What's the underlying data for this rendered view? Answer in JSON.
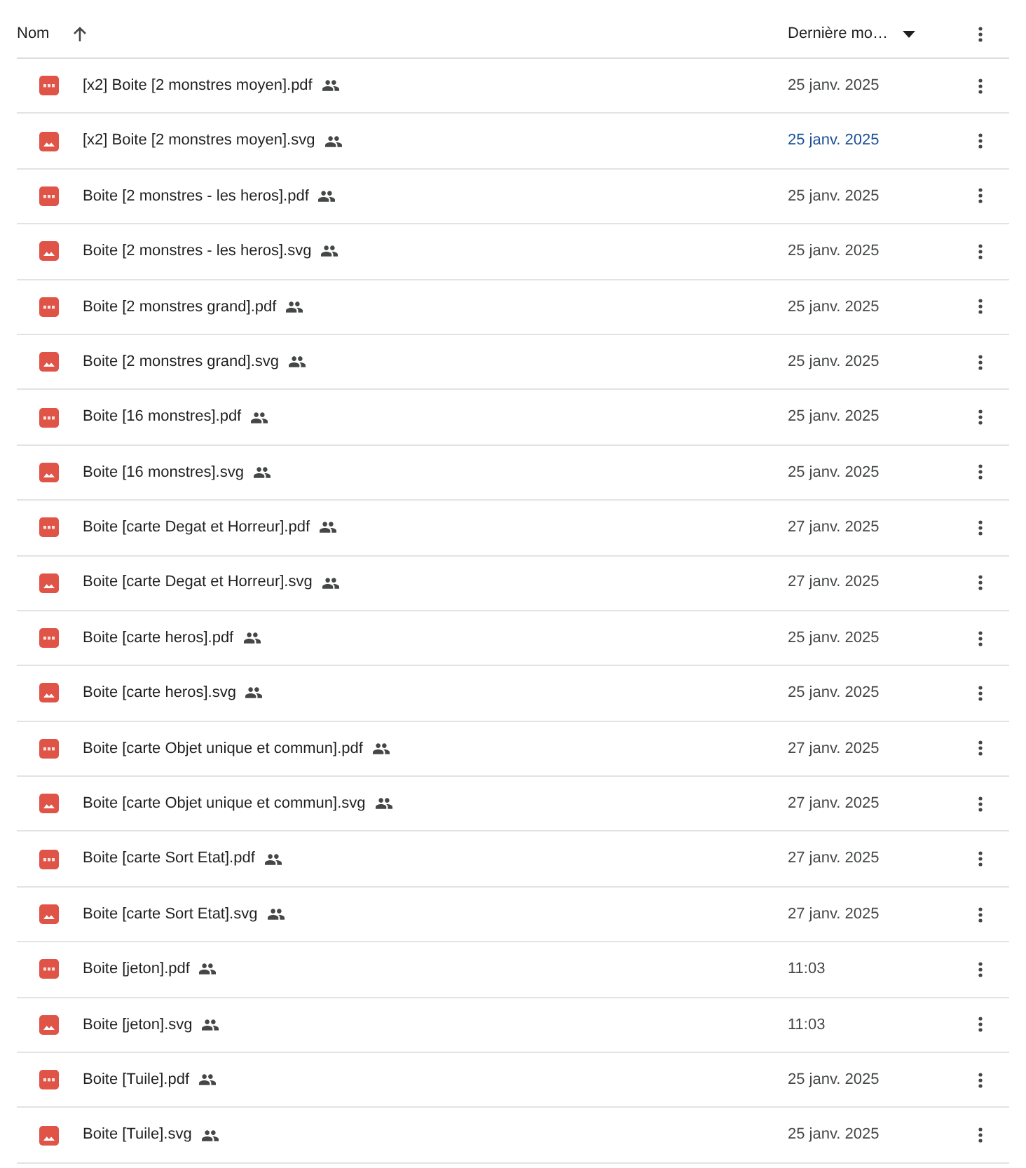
{
  "columns": [
    {
      "label": "Nom",
      "kind": "sort-ascending"
    },
    {
      "label": "Dernière mo…",
      "kind": "dropdown"
    }
  ],
  "rows": [
    {
      "name": "[x2] Boite [2 monstres moyen].pdf",
      "kind": "pdf",
      "shared": true,
      "modified": "25 janv. 2025",
      "hovered": false
    },
    {
      "name": "[x2] Boite [2 monstres moyen].svg",
      "kind": "image",
      "shared": true,
      "modified": "25 janv. 2025",
      "hovered": true
    },
    {
      "name": "Boite [2 monstres - les heros].pdf",
      "kind": "pdf",
      "shared": true,
      "modified": "25 janv. 2025",
      "hovered": false
    },
    {
      "name": "Boite [2 monstres - les heros].svg",
      "kind": "image",
      "shared": true,
      "modified": "25 janv. 2025",
      "hovered": false
    },
    {
      "name": "Boite [2 monstres grand].pdf",
      "kind": "pdf",
      "shared": true,
      "modified": "25 janv. 2025",
      "hovered": false
    },
    {
      "name": "Boite [2 monstres grand].svg",
      "kind": "image",
      "shared": true,
      "modified": "25 janv. 2025",
      "hovered": false
    },
    {
      "name": "Boite [16 monstres].pdf",
      "kind": "pdf",
      "shared": true,
      "modified": "25 janv. 2025",
      "hovered": false
    },
    {
      "name": "Boite [16 monstres].svg",
      "kind": "image",
      "shared": true,
      "modified": "25 janv. 2025",
      "hovered": false
    },
    {
      "name": "Boite [carte Degat et Horreur].pdf",
      "kind": "pdf",
      "shared": true,
      "modified": "27 janv. 2025",
      "hovered": false
    },
    {
      "name": "Boite [carte Degat et Horreur].svg",
      "kind": "image",
      "shared": true,
      "modified": "27 janv. 2025",
      "hovered": false
    },
    {
      "name": "Boite [carte heros].pdf",
      "kind": "pdf",
      "shared": true,
      "modified": "25 janv. 2025",
      "hovered": false
    },
    {
      "name": "Boite [carte heros].svg",
      "kind": "image",
      "shared": true,
      "modified": "25 janv. 2025",
      "hovered": false
    },
    {
      "name": "Boite [carte Objet unique et commun].pdf",
      "kind": "pdf",
      "shared": true,
      "modified": "27 janv. 2025",
      "hovered": false
    },
    {
      "name": "Boite [carte Objet unique et commun].svg",
      "kind": "image",
      "shared": true,
      "modified": "27 janv. 2025",
      "hovered": false
    },
    {
      "name": "Boite [carte Sort Etat].pdf",
      "kind": "pdf",
      "shared": true,
      "modified": "27 janv. 2025",
      "hovered": false
    },
    {
      "name": "Boite [carte Sort Etat].svg",
      "kind": "image",
      "shared": true,
      "modified": "27 janv. 2025",
      "hovered": false
    },
    {
      "name": "Boite [jeton].pdf",
      "kind": "pdf",
      "shared": true,
      "modified": "11:03",
      "hovered": false
    },
    {
      "name": "Boite [jeton].svg",
      "kind": "image",
      "shared": true,
      "modified": "11:03",
      "hovered": false
    },
    {
      "name": "Boite [Tuile].pdf",
      "kind": "pdf",
      "shared": true,
      "modified": "25 janv. 2025",
      "hovered": false
    },
    {
      "name": "Boite [Tuile].svg",
      "kind": "image",
      "shared": true,
      "modified": "25 janv. 2025",
      "hovered": false
    }
  ]
}
